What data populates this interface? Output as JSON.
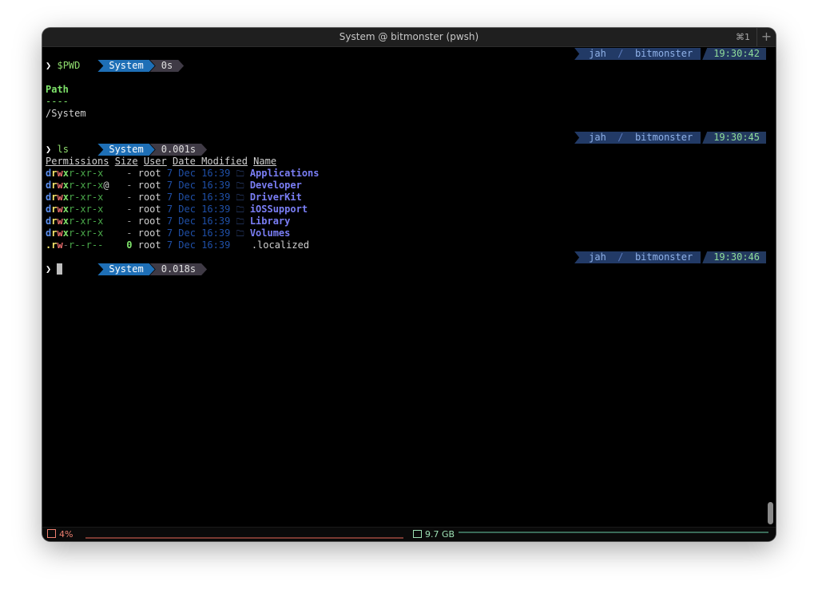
{
  "window": {
    "title": "System @ bitmonster (pwsh)",
    "shortcut": "⌘1",
    "new_tab": "+"
  },
  "prompts": [
    {
      "dir": "System",
      "duration": "0s",
      "user": "jah",
      "host": "bitmonster",
      "clock": "19:30:42",
      "command": "$PWD"
    },
    {
      "dir": "System",
      "duration": "0.001s",
      "user": "jah",
      "host": "bitmonster",
      "clock": "19:30:45",
      "command": "ls"
    },
    {
      "dir": "System",
      "duration": "0.018s",
      "user": "jah",
      "host": "bitmonster",
      "clock": "19:30:46",
      "command": ""
    }
  ],
  "prompt_glyph": "❯",
  "separator": "/",
  "pwd_output": {
    "header": "Path",
    "underline": "----",
    "value": "/System"
  },
  "ls": {
    "headers": {
      "permissions": "Permissions",
      "size": "Size",
      "user": "User",
      "date": "Date Modified",
      "name": "Name"
    },
    "rows": [
      {
        "perm": [
          "d",
          "r",
          "w",
          "x",
          "r",
          "-",
          "x",
          "r",
          "-",
          "x"
        ],
        "perm_suffix": "",
        "size": "-",
        "user": "root",
        "date": "7 Dec 16:39",
        "icon": "folder-icon",
        "name": "Applications",
        "kind": "dir"
      },
      {
        "perm": [
          "d",
          "r",
          "w",
          "x",
          "r",
          "-",
          "x",
          "r",
          "-",
          "x"
        ],
        "perm_suffix": "@",
        "size": "-",
        "user": "root",
        "date": "7 Dec 16:39",
        "icon": "folder-icon",
        "name": "Developer",
        "kind": "dir"
      },
      {
        "perm": [
          "d",
          "r",
          "w",
          "x",
          "r",
          "-",
          "x",
          "r",
          "-",
          "x"
        ],
        "perm_suffix": "",
        "size": "-",
        "user": "root",
        "date": "7 Dec 16:39",
        "icon": "folder-icon",
        "name": "DriverKit",
        "kind": "dir"
      },
      {
        "perm": [
          "d",
          "r",
          "w",
          "x",
          "r",
          "-",
          "x",
          "r",
          "-",
          "x"
        ],
        "perm_suffix": "",
        "size": "-",
        "user": "root",
        "date": "7 Dec 16:39",
        "icon": "folder-icon",
        "name": "iOSSupport",
        "kind": "dir"
      },
      {
        "perm": [
          "d",
          "r",
          "w",
          "x",
          "r",
          "-",
          "x",
          "r",
          "-",
          "x"
        ],
        "perm_suffix": "",
        "size": "-",
        "user": "root",
        "date": "7 Dec 16:39",
        "icon": "folder-icon",
        "name": "Library",
        "kind": "dir"
      },
      {
        "perm": [
          "d",
          "r",
          "w",
          "x",
          "r",
          "-",
          "x",
          "r",
          "-",
          "x"
        ],
        "perm_suffix": "",
        "size": "-",
        "user": "root",
        "date": "7 Dec 16:39",
        "icon": "folder-icon",
        "name": "Volumes",
        "kind": "dir"
      },
      {
        "perm": [
          ".",
          "r",
          "w",
          "-",
          "r",
          "-",
          "-",
          "r",
          "-",
          "-"
        ],
        "perm_suffix": "",
        "size": "0",
        "user": "root",
        "date": "7 Dec 16:39",
        "icon": "apple-icon",
        "name": ".localized",
        "kind": "file"
      }
    ]
  },
  "statusbar": {
    "cpu": "4%",
    "memory": "9.7 GB"
  },
  "icons": {
    "apple": "",
    "folder": "🗀"
  }
}
